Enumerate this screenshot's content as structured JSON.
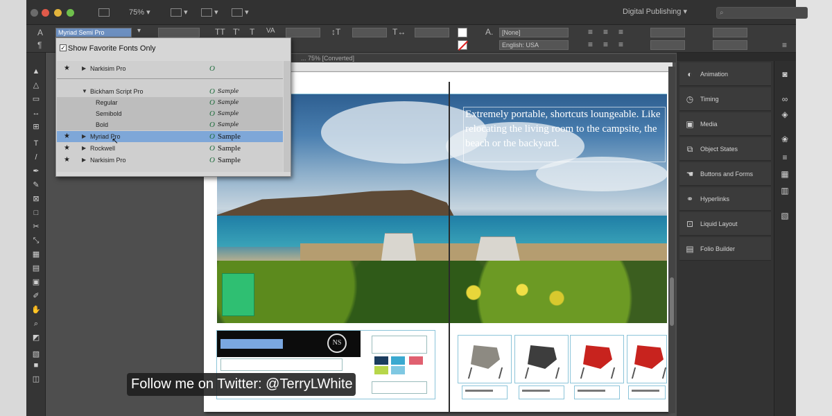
{
  "window": {
    "zoom": "75%",
    "workspace": "Digital Publishing",
    "document_tab": "... 75% [Converted]"
  },
  "control_bar": {
    "font_family": "Myriad Semi Pro",
    "fill_label": "[None]",
    "language": "English: USA"
  },
  "font_menu": {
    "header": "Show Favorite Fonts Only",
    "rows": [
      {
        "name": "Narkisim Pro",
        "star": "★",
        "sample": ""
      },
      {
        "name": "Bickham Script Pro",
        "star": "",
        "sample": "Sample"
      },
      {
        "name": "Regular",
        "star": "",
        "sample": "Sample"
      },
      {
        "name": "Semibold",
        "star": "",
        "sample": "Sample"
      },
      {
        "name": "Bold",
        "star": "",
        "sample": "Sample"
      },
      {
        "name": "Myriad Pro",
        "star": "★",
        "sample": "Sample"
      },
      {
        "name": "Rockwell",
        "star": "★",
        "sample": "Sample"
      },
      {
        "name": "Narkisim Pro",
        "star": "★",
        "sample": "Sample"
      }
    ]
  },
  "panels": [
    {
      "label": "Animation",
      "icon": "animation-icon"
    },
    {
      "label": "Timing",
      "icon": "timing-icon"
    },
    {
      "label": "Media",
      "icon": "media-icon"
    },
    {
      "label": "Object States",
      "icon": "object-states-icon"
    },
    {
      "label": "Buttons and Forms",
      "icon": "buttons-forms-icon"
    },
    {
      "label": "Hyperlinks",
      "icon": "hyperlinks-icon"
    },
    {
      "label": "Liquid Layout",
      "icon": "liquid-layout-icon"
    },
    {
      "label": "Folio Builder",
      "icon": "folio-builder-icon"
    }
  ],
  "document": {
    "hero_text": "Extremely portable, shortcuts loungeable. Like relocating the living room to the campsite, the beach or the backyard.",
    "logo_initials": "NS"
  },
  "overlay": {
    "twitter": "Follow me on Twitter: @TerryLWhite"
  },
  "colors": {
    "accent_green": "#2fbf72",
    "selection_blue": "#7ea7d8",
    "chair_red": "#c8231e"
  }
}
